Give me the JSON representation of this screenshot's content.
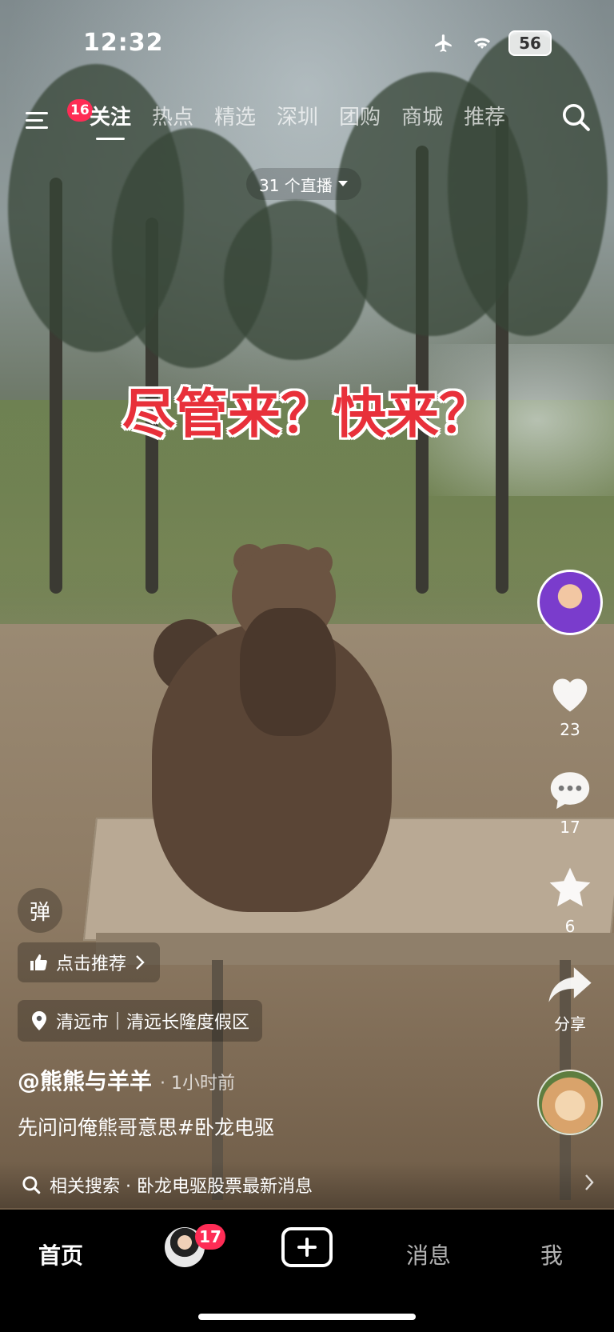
{
  "status_bar": {
    "time": "12:32",
    "battery": "56"
  },
  "top_nav": {
    "menu_badge": "16",
    "tabs": [
      "关注",
      "热点",
      "精选",
      "深圳",
      "团购",
      "商城",
      "推荐"
    ],
    "active_tab": "关注"
  },
  "live_pill": "31 个直播",
  "headline": "尽管来？快来？",
  "actions": {
    "like_count": "23",
    "comment_count": "17",
    "favorite_count": "6",
    "share_label": "分享"
  },
  "overlay": {
    "danmu_label": "弹",
    "recommend_label": "点击推荐",
    "location_city": "清远市",
    "location_place": "清远长隆度假区",
    "author": "@熊熊与羊羊",
    "time": "· 1小时前",
    "description": "先问问俺熊哥意思#卧龙电驱",
    "related_search": "相关搜索 · 卧龙电驱股票最新消息"
  },
  "tabbar": {
    "home": "首页",
    "friends_badge": "17",
    "messages": "消息",
    "me": "我"
  },
  "colors": {
    "accent": "#fe2c55",
    "headline": "#e8303a"
  }
}
